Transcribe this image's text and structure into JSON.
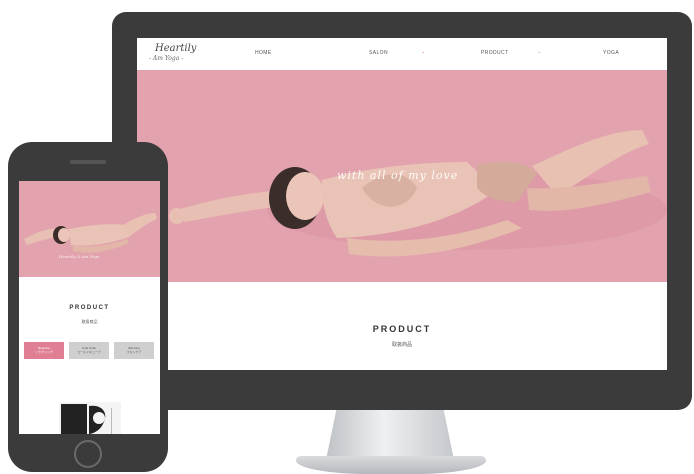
{
  "desktop": {
    "logo": {
      "main": "Heartily",
      "sub": "- Am Yoga -"
    },
    "nav": {
      "items": [
        {
          "label": "HOME"
        },
        {
          "label": "SALON"
        },
        {
          "label": "PRODUCT"
        },
        {
          "label": "YOGA"
        }
      ],
      "dropdown_icon": "chevron-down-icon"
    },
    "hero": {
      "tagline": "with all of my love",
      "background_color": "#e3a3ae"
    },
    "section": {
      "title": "PRODUCT",
      "subtitle": "取扱商品"
    }
  },
  "mobile": {
    "hero": {
      "tagline": "Heartily & Am Yoga"
    },
    "section": {
      "title": "PRODUCT",
      "subtitle": "取扱商品"
    },
    "tabs": [
      {
        "label": "Relaxing",
        "sub": "リラクシング"
      },
      {
        "label": "Cold Cube",
        "sub": "コールドキューブ"
      },
      {
        "label": "Skincare",
        "sub": "スキンケア"
      }
    ]
  },
  "colors": {
    "accent": "#e07f93",
    "device": "#3b3b3b",
    "hero": "#e3a3ae"
  }
}
